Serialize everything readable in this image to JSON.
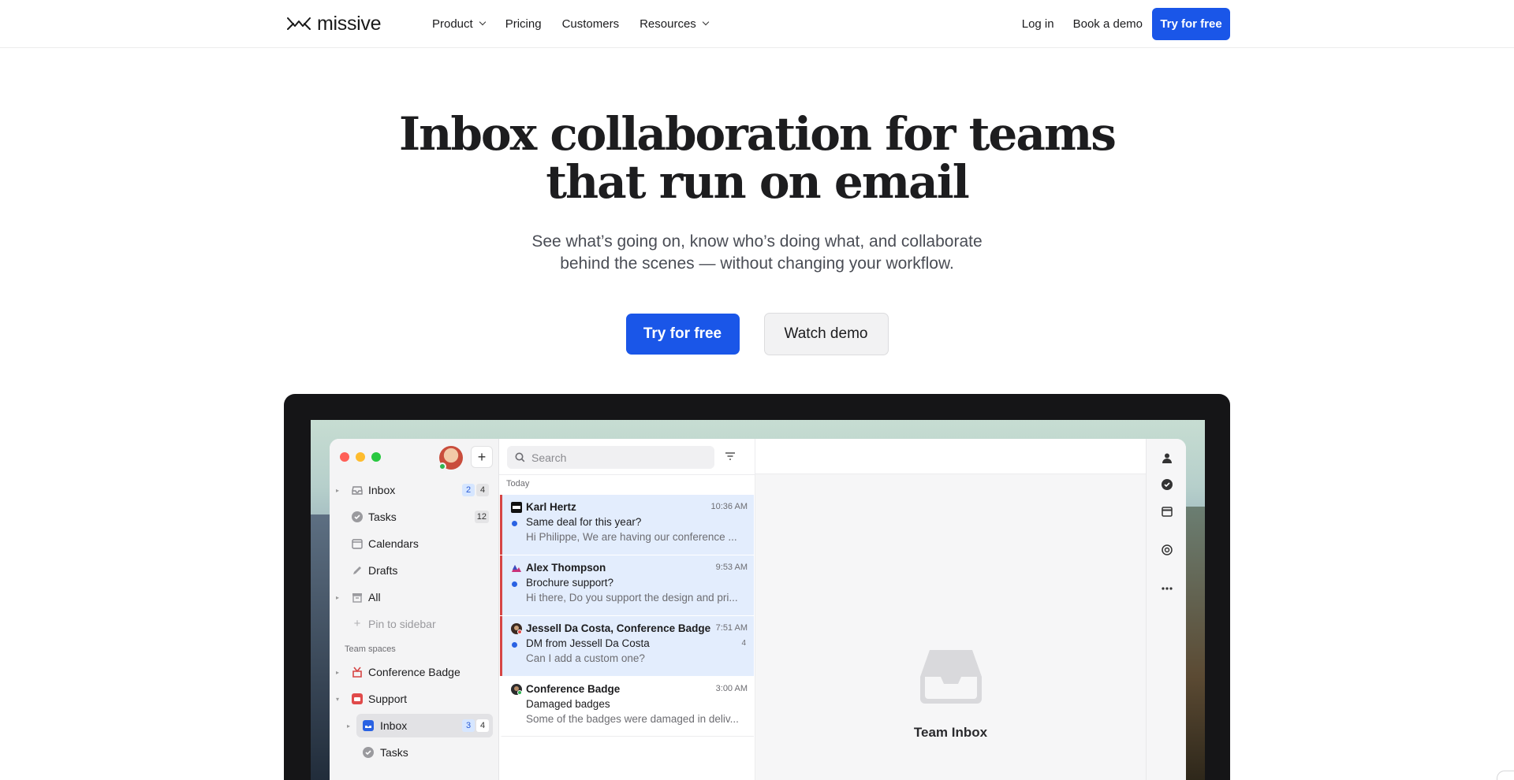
{
  "nav": {
    "logo_text": "missive",
    "links": [
      {
        "label": "Product",
        "dropdown": true
      },
      {
        "label": "Pricing",
        "dropdown": false
      },
      {
        "label": "Customers",
        "dropdown": false
      },
      {
        "label": "Resources",
        "dropdown": true
      }
    ],
    "login": "Log in",
    "book_demo": "Book a demo",
    "try_free": "Try for free"
  },
  "hero": {
    "title_line1": "Inbox collaboration for teams",
    "title_line2": "that run on email",
    "subtitle_line1": "See what’s going on, know who’s doing what, and collaborate",
    "subtitle_line2": "behind the scenes — without changing your workflow.",
    "primary_cta": "Try for free",
    "secondary_cta": "Watch demo"
  },
  "app": {
    "sidebar": {
      "items": [
        {
          "label": "Inbox",
          "icon": "inbox-icon",
          "badges": [
            "2",
            "4"
          ]
        },
        {
          "label": "Tasks",
          "icon": "check-circle-icon",
          "badges": [
            "12"
          ]
        },
        {
          "label": "Calendars",
          "icon": "calendar-icon",
          "badges": []
        },
        {
          "label": "Drafts",
          "icon": "pencil-icon",
          "badges": []
        },
        {
          "label": "All",
          "icon": "archive-icon",
          "badges": []
        },
        {
          "label": "Pin to sidebar",
          "icon": "plus-icon",
          "badges": []
        }
      ],
      "team_spaces_label": "Team spaces",
      "teams": [
        {
          "label": "Conference Badge",
          "icon": "badge-logo-icon"
        },
        {
          "label": "Support",
          "icon": "support-logo-icon"
        }
      ],
      "support_children": [
        {
          "label": "Inbox",
          "icon": "inbox-icon",
          "badges": [
            "3",
            "4"
          ]
        },
        {
          "label": "Tasks",
          "icon": "check-circle-icon",
          "badges": []
        }
      ]
    },
    "list": {
      "search_placeholder": "Search",
      "section": "Today",
      "conversations": [
        {
          "from": "Karl Hertz",
          "time": "10:36 AM",
          "subject": "Same deal for this year?",
          "preview": "Hi Philippe, We are having our conference ...",
          "count": ""
        },
        {
          "from": "Alex Thompson",
          "time": "9:53 AM",
          "subject": "Brochure support?",
          "preview": "Hi there, Do you support the design and pri...",
          "count": ""
        },
        {
          "from": "Jessell Da Costa, Conference Badge",
          "time": "7:51 AM",
          "subject": "DM from Jessell Da Costa",
          "preview": "Can I add a custom one?",
          "count": "4"
        },
        {
          "from": "Conference Badge",
          "time": "3:00 AM",
          "subject": "Damaged badges",
          "preview": "Some of the badges were damaged in deliv...",
          "count": ""
        }
      ]
    },
    "detail": {
      "empty_title": "Team Inbox"
    },
    "rail_icons": [
      "person-icon",
      "check-circle-icon",
      "calendar-icon",
      "openai-icon",
      "more-icon"
    ]
  },
  "colors": {
    "brand_blue": "#1a56e8",
    "highlight_row": "#e3edfd",
    "unread_bar": "#d64545"
  }
}
